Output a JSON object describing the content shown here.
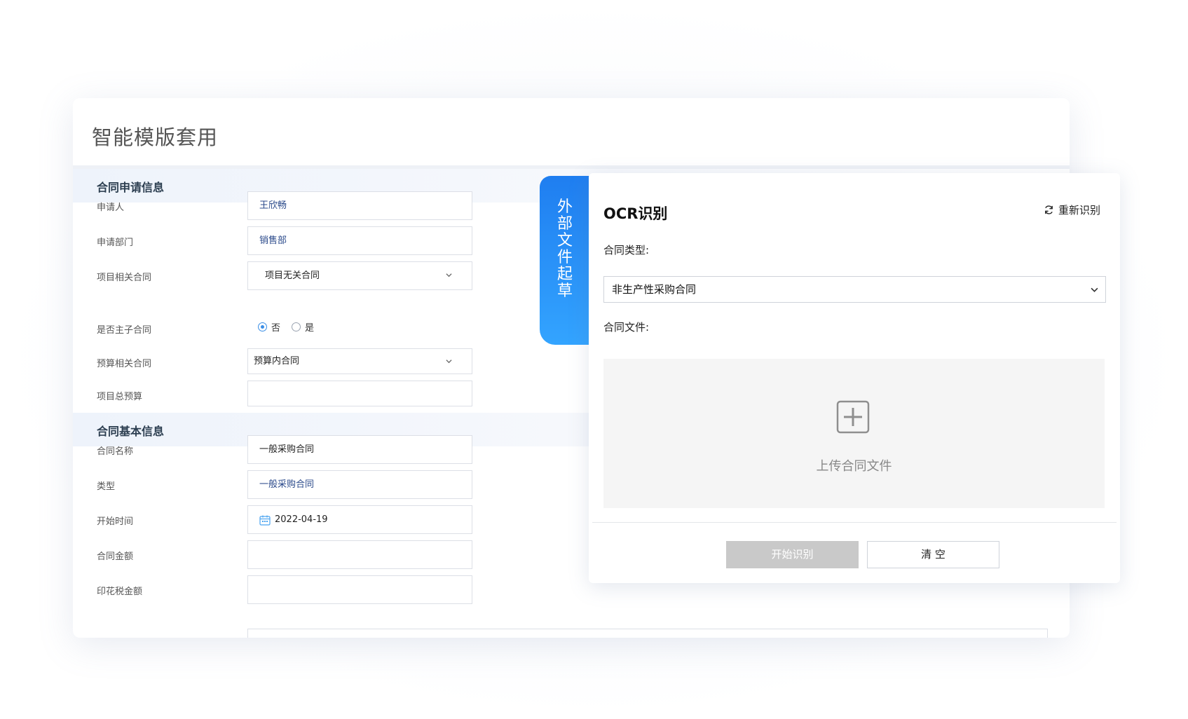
{
  "page": {
    "title": "智能模版套用"
  },
  "sections": {
    "apply_info": "合同申请信息",
    "basic_info": "合同基本信息"
  },
  "form": {
    "applicant": {
      "label": "申请人",
      "value": "王欣畅"
    },
    "department": {
      "label": "申请部门",
      "value": "销售部"
    },
    "project_related": {
      "label": "项目相关合同",
      "value": "项目无关合同"
    },
    "is_master": {
      "label": "是否主子合同",
      "option_no": "否",
      "option_yes": "是",
      "selected": "否"
    },
    "budget_related": {
      "label": "预算相关合同",
      "value": "预算内合同"
    },
    "project_budget": {
      "label": "项目总预算",
      "value": ""
    },
    "contract_name": {
      "label": "合同名称",
      "value": "一般采购合同"
    },
    "type": {
      "label": "类型",
      "value": "一般采购合同"
    },
    "start_time": {
      "label": "开始时间",
      "value": "2022-04-19"
    },
    "amount": {
      "label": "合同金额",
      "value": ""
    },
    "stamp_tax": {
      "label": "印花税金额",
      "value": ""
    }
  },
  "side_tab": {
    "chars": [
      "外",
      "部",
      "文",
      "件",
      "起",
      "草"
    ]
  },
  "ocr": {
    "title": "OCR识别",
    "refresh_label": "重新识别",
    "contract_type_label": "合同类型:",
    "contract_type_value": "非生产性采购合同",
    "contract_file_label": "合同文件:",
    "upload_text": "上传合同文件",
    "start_button": "开始识别",
    "clear_button": "清 空"
  },
  "colors": {
    "accent_blue": "#1f7ef0",
    "value_blue": "#2b4a8b",
    "disabled_gray": "#c9c9c9"
  }
}
